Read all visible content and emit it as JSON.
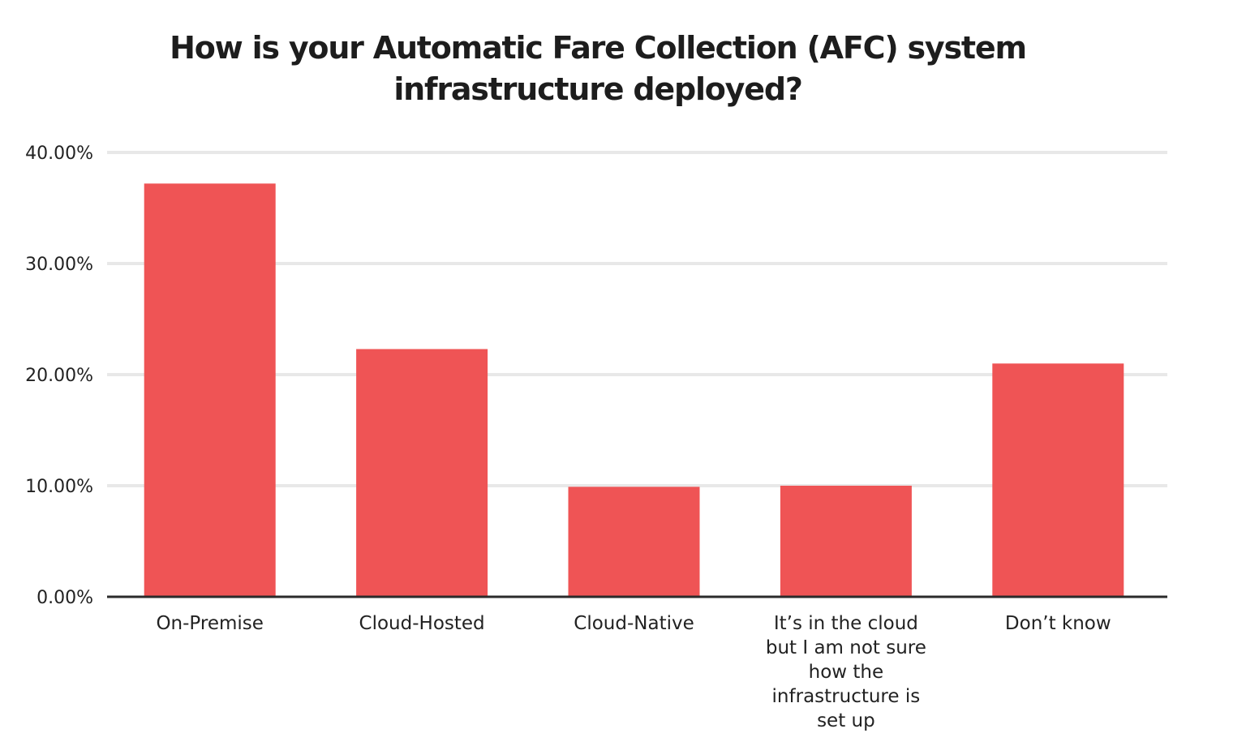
{
  "chart_data": {
    "type": "bar",
    "title": "How is your  Automatic Fare Collection (AFC) system infrastructure deployed?",
    "title_lines": [
      "How is your  Automatic Fare Collection (AFC) system",
      "infrastructure deployed?"
    ],
    "categories": [
      "On-Premise",
      "Cloud-Hosted",
      "Cloud-Native",
      "It’s in the cloud but I am not sure how the infrastructure is set up",
      "Don’t know"
    ],
    "category_lines": [
      [
        "On-Premise"
      ],
      [
        "Cloud-Hosted"
      ],
      [
        "Cloud-Native"
      ],
      [
        "It’s in the cloud",
        "but I am not sure",
        "how the",
        "infrastructure is",
        "set up"
      ],
      [
        "Don’t know"
      ]
    ],
    "values": [
      37.2,
      22.3,
      9.9,
      10.0,
      21.0
    ],
    "unit": "%",
    "xlabel": "",
    "ylabel": "",
    "ylim": [
      0,
      40
    ],
    "yticks": [
      0,
      10,
      20,
      30,
      40
    ],
    "ytick_labels": [
      "0.00%",
      "10.00%",
      "20.00%",
      "30.00%",
      "40.00%"
    ],
    "grid": true,
    "legend": "none",
    "colors": {
      "bar": "#EF5455",
      "grid": "#E8E8E8",
      "axis": "#2B2B2B"
    }
  }
}
